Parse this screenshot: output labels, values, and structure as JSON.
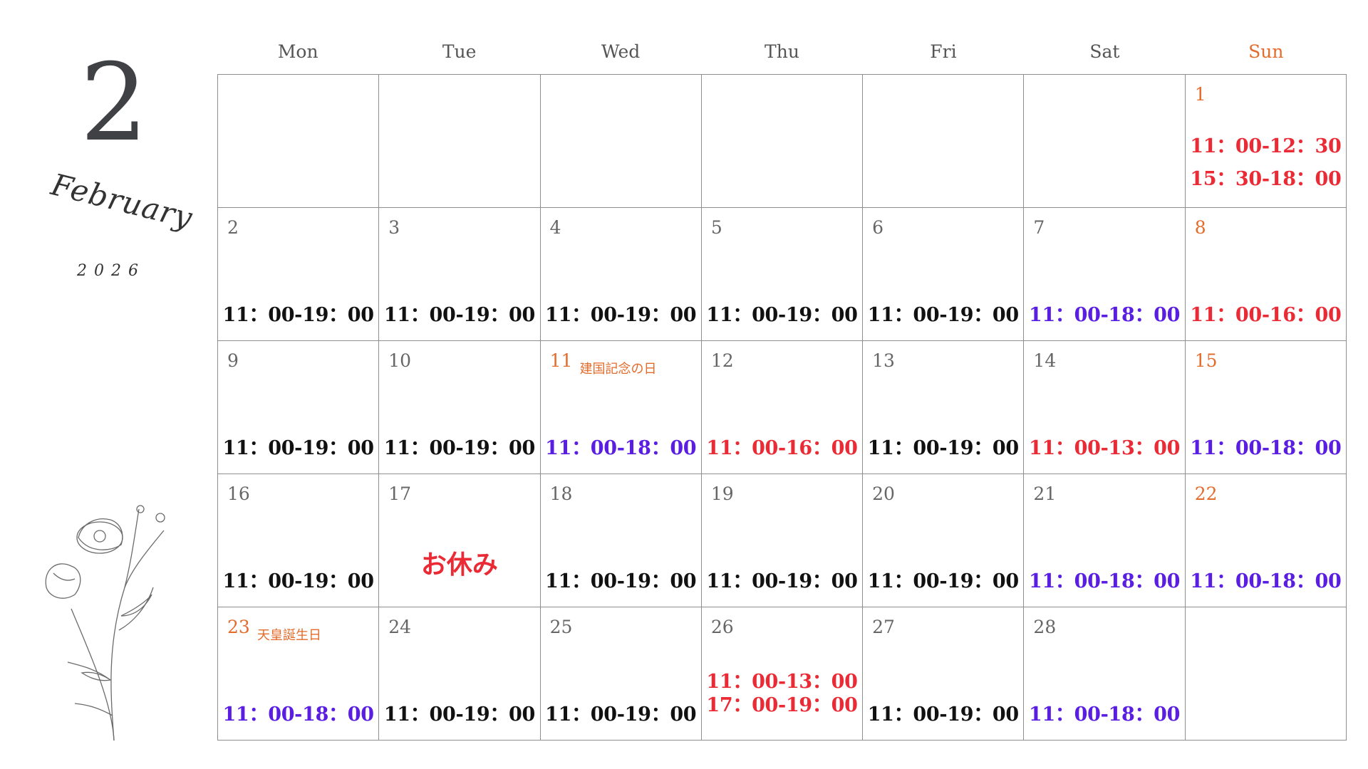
{
  "month": {
    "number": "2",
    "name": "February",
    "year": "2026"
  },
  "weekdays": [
    "Mon",
    "Tue",
    "Wed",
    "Thu",
    "Fri",
    "Sat",
    "Sun"
  ],
  "colors": {
    "black": "#111111",
    "red": "#ea2b35",
    "purple": "#5a1ee3",
    "orange": "#e36b2b"
  },
  "cells": [
    {
      "day": "",
      "hours": []
    },
    {
      "day": "",
      "hours": []
    },
    {
      "day": "",
      "hours": []
    },
    {
      "day": "",
      "hours": []
    },
    {
      "day": "",
      "hours": []
    },
    {
      "day": "",
      "hours": []
    },
    {
      "day": "1",
      "orange": true,
      "hours": [
        {
          "text": "11：00-12：30",
          "color": "red"
        },
        {
          "text": "15：30-18：00",
          "color": "red"
        }
      ]
    },
    {
      "day": "2",
      "hours": [
        {
          "text": "11：00-19：00",
          "color": "black"
        }
      ]
    },
    {
      "day": "3",
      "hours": [
        {
          "text": "11：00-19：00",
          "color": "black"
        }
      ]
    },
    {
      "day": "4",
      "hours": [
        {
          "text": "11：00-19：00",
          "color": "black"
        }
      ]
    },
    {
      "day": "5",
      "hours": [
        {
          "text": "11：00-19：00",
          "color": "black"
        }
      ]
    },
    {
      "day": "6",
      "hours": [
        {
          "text": "11：00-19：00",
          "color": "black"
        }
      ]
    },
    {
      "day": "7",
      "hours": [
        {
          "text": "11：00-18：00",
          "color": "purple"
        }
      ]
    },
    {
      "day": "8",
      "orange": true,
      "hours": [
        {
          "text": "11：00-16：00",
          "color": "red"
        }
      ]
    },
    {
      "day": "9",
      "hours": [
        {
          "text": "11：00-19：00",
          "color": "black"
        }
      ]
    },
    {
      "day": "10",
      "hours": [
        {
          "text": "11：00-19：00",
          "color": "black"
        }
      ]
    },
    {
      "day": "11",
      "orange": true,
      "holiday": "建国記念の日",
      "hours": [
        {
          "text": "11：00-18：00",
          "color": "purple"
        }
      ]
    },
    {
      "day": "12",
      "hours": [
        {
          "text": "11：00-16：00",
          "color": "red"
        }
      ]
    },
    {
      "day": "13",
      "hours": [
        {
          "text": "11：00-19：00",
          "color": "black"
        }
      ]
    },
    {
      "day": "14",
      "hours": [
        {
          "text": "11：00-13：00",
          "color": "red"
        }
      ]
    },
    {
      "day": "15",
      "orange": true,
      "hours": [
        {
          "text": "11：00-18：00",
          "color": "purple"
        }
      ]
    },
    {
      "day": "16",
      "hours": [
        {
          "text": "11：00-19：00",
          "color": "black"
        }
      ]
    },
    {
      "day": "17",
      "closed": "お休み",
      "hours": []
    },
    {
      "day": "18",
      "hours": [
        {
          "text": "11：00-19：00",
          "color": "black"
        }
      ]
    },
    {
      "day": "19",
      "hours": [
        {
          "text": "11：00-19：00",
          "color": "black"
        }
      ]
    },
    {
      "day": "20",
      "hours": [
        {
          "text": "11：00-19：00",
          "color": "black"
        }
      ]
    },
    {
      "day": "21",
      "hours": [
        {
          "text": "11：00-18：00",
          "color": "purple"
        }
      ]
    },
    {
      "day": "22",
      "orange": true,
      "hours": [
        {
          "text": "11：00-18：00",
          "color": "purple"
        }
      ]
    },
    {
      "day": "23",
      "orange": true,
      "holiday": "天皇誕生日",
      "hours": [
        {
          "text": "11：00-18：00",
          "color": "purple"
        }
      ]
    },
    {
      "day": "24",
      "hours": [
        {
          "text": "11：00-19：00",
          "color": "black"
        }
      ]
    },
    {
      "day": "25",
      "hours": [
        {
          "text": "11：00-19：00",
          "color": "black"
        }
      ]
    },
    {
      "day": "26",
      "hours": [
        {
          "text": "11：00-13：00",
          "color": "red"
        },
        {
          "text": "17：00-19：00",
          "color": "red"
        }
      ]
    },
    {
      "day": "27",
      "hours": [
        {
          "text": "11：00-19：00",
          "color": "black"
        }
      ]
    },
    {
      "day": "28",
      "hours": [
        {
          "text": "11：00-18：00",
          "color": "purple"
        }
      ]
    },
    {
      "day": "",
      "hours": []
    }
  ]
}
